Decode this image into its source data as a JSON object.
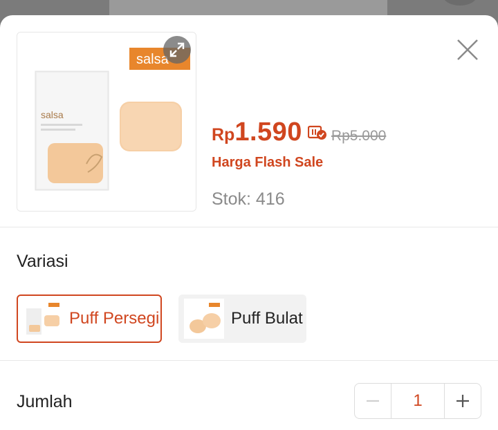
{
  "product": {
    "brand_on_pack": "salsa",
    "price_currency": "Rp",
    "price_value": "1.590",
    "original_price": "Rp5.000",
    "flash_sale_label": "Harga Flash Sale",
    "stock_text": "Stok: 416"
  },
  "icons": {
    "expand": "expand-arrows-icon",
    "close": "close-icon",
    "voucher": "coin-voucher-check-icon",
    "minus": "minus-icon",
    "plus": "plus-icon"
  },
  "variation": {
    "title": "Variasi",
    "options": [
      {
        "label": "Puff Persegi",
        "selected": true
      },
      {
        "label": "Puff Bulat",
        "selected": false
      }
    ]
  },
  "quantity": {
    "title": "Jumlah",
    "value": "1"
  },
  "colors": {
    "accent": "#d0461f",
    "text": "#222222",
    "muted": "#8a8a8a"
  }
}
